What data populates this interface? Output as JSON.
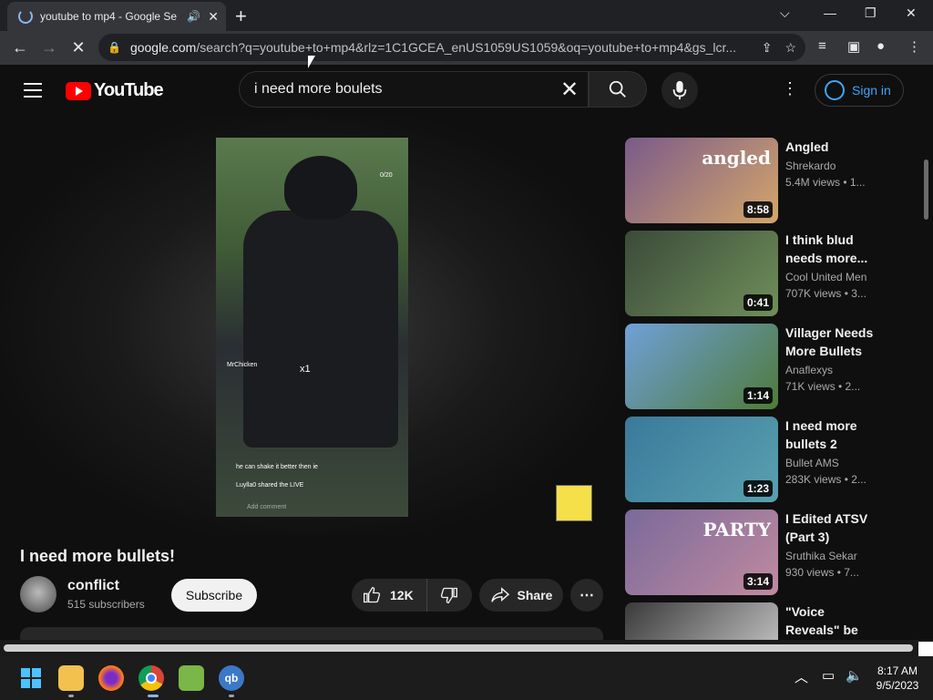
{
  "browser": {
    "tab_title": "youtube to mp4 - Google Se",
    "url_host": "google.com",
    "url_path": "/search?q=youtube+to+mp4&rlz=1C1GCEA_enUS1059US1059&oq=youtube+to+mp4&gs_lcr..."
  },
  "youtube": {
    "logo_text": "YouTube",
    "search_query": "i need more boulets",
    "sign_in_label": "Sign in"
  },
  "video": {
    "overlay_user": "MrChicken",
    "overlay_multiplier": "x1",
    "overlay_comment": "he can shake it better then ie",
    "overlay_shared": "Luylla0 shared the LIVE",
    "overlay_add_comment": "Add comment",
    "overlay_count": "0/20",
    "title": "I need more bullets!",
    "channel": "conflict",
    "subscribers": "515 subscribers",
    "subscribe_label": "Subscribe",
    "likes": "12K",
    "share_label": "Share"
  },
  "related": [
    {
      "title": "Angled",
      "channel": "Shrekardo",
      "meta": "5.4M views • 1...",
      "duration": "8:58",
      "thumb_text": "angled",
      "colors": [
        "#7a5a8a",
        "#d4a66a"
      ]
    },
    {
      "title": "I think blud needs more...",
      "channel": "Cool United Men",
      "meta": "707K views • 3...",
      "duration": "0:41",
      "colors": [
        "#3b4a3a",
        "#6f8f5a"
      ]
    },
    {
      "title": "Villager Needs More Bullets -...",
      "channel": "Anaflexys",
      "meta": "71K views • 2...",
      "duration": "1:14",
      "colors": [
        "#6fa0d8",
        "#4f7a3a"
      ]
    },
    {
      "title": "I need more bullets 2",
      "channel": "Bullet AMS",
      "meta": "283K views • 2...",
      "duration": "1:23",
      "colors": [
        "#3a7a9a",
        "#5aa0b0"
      ]
    },
    {
      "title": "I Edited ATSV (Part 3)",
      "channel": "Sruthika Sekar",
      "meta": "930 views • 7...",
      "duration": "3:14",
      "thumb_text": "PARTY",
      "colors": [
        "#7a6a9a",
        "#c08aa0"
      ]
    },
    {
      "title": "\"Voice Reveals\" be like...",
      "channel": "",
      "meta": "",
      "duration": "",
      "colors": [
        "#3a3a3a",
        "#d8d8d8"
      ]
    }
  ],
  "taskbar": {
    "time": "8:17 AM",
    "date": "9/5/2023",
    "qb_label": "qb"
  }
}
